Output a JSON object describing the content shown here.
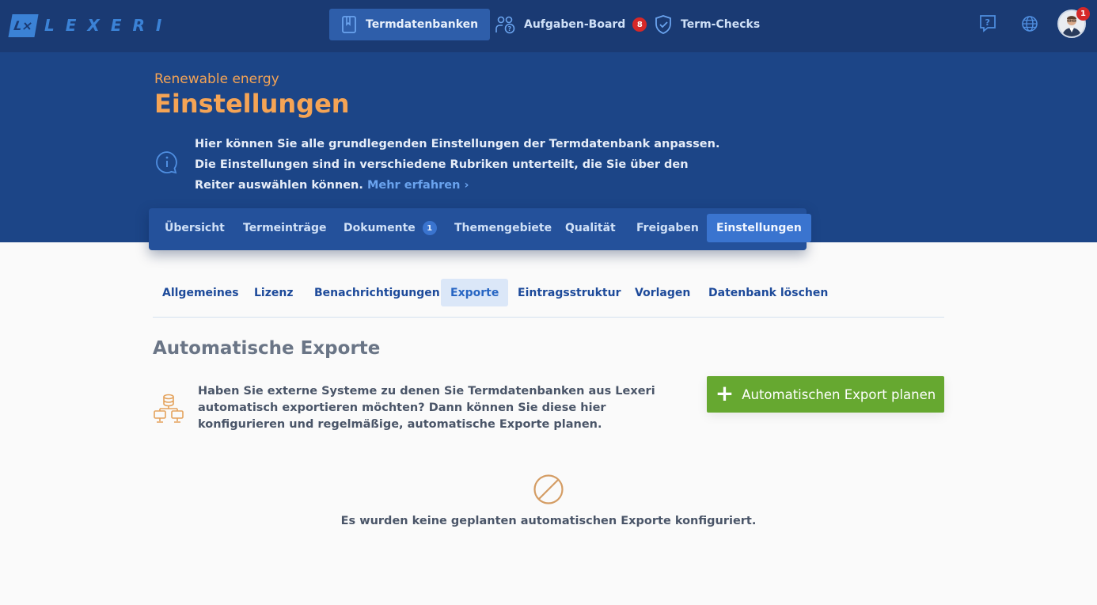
{
  "app": {
    "logo_mark": "L×",
    "logo_text": "LEXERI"
  },
  "topnav": {
    "items": [
      {
        "label": "Termdatenbanken",
        "icon": "book-icon"
      },
      {
        "label": "Aufgaben-Board",
        "icon": "users-question-icon",
        "badge": "8"
      },
      {
        "label": "Term-Checks",
        "icon": "shield-check-icon"
      }
    ],
    "help_icon": "help-chat-icon",
    "language_icon": "globe-icon",
    "avatar_badge": "1"
  },
  "hero": {
    "subtitle": "Renewable energy",
    "title": "Einstellungen",
    "info_text": "Hier können Sie alle grundlegenden Einstellungen der Termdatenbank anpassen. Die Einstellungen sind in verschiedene Rubriken unterteilt, die Sie über den Reiter auswählen können.",
    "link_text": "Mehr erfahren ›"
  },
  "main_tabs": [
    {
      "label": "Übersicht"
    },
    {
      "label": "Termeinträge"
    },
    {
      "label": "Dokumente",
      "badge": "1"
    },
    {
      "label": "Themengebiete"
    },
    {
      "label": "Qualität"
    },
    {
      "label": "Freigaben"
    },
    {
      "label": "Einstellungen",
      "active": true
    }
  ],
  "sub_tabs": [
    {
      "label": "Allgemeines"
    },
    {
      "label": "Lizenz"
    },
    {
      "label": "Benachrichtigungen"
    },
    {
      "label": "Exporte",
      "active": true
    },
    {
      "label": "Eintragsstruktur"
    },
    {
      "label": "Vorlagen"
    },
    {
      "label": "Datenbank löschen"
    }
  ],
  "section": {
    "title": "Automatische Exporte",
    "description": "Haben Sie externe Systeme zu denen Sie Termdatenbanken aus Lexeri automatisch exportieren möchten? Dann können Sie diese hier konfigurieren und regelmäßige, automatische Exporte planen.",
    "button_label": "Automatischen Export planen",
    "empty_text": "Es wurden keine geplanten automatischen Exporte konfiguriert."
  },
  "colors": {
    "topbar": "#1a3a73",
    "hero": "#1c4587",
    "accent_orange": "#f5a455",
    "accent_blue": "#3a74cf",
    "button_green": "#66a830",
    "badge_red": "#d62828"
  }
}
